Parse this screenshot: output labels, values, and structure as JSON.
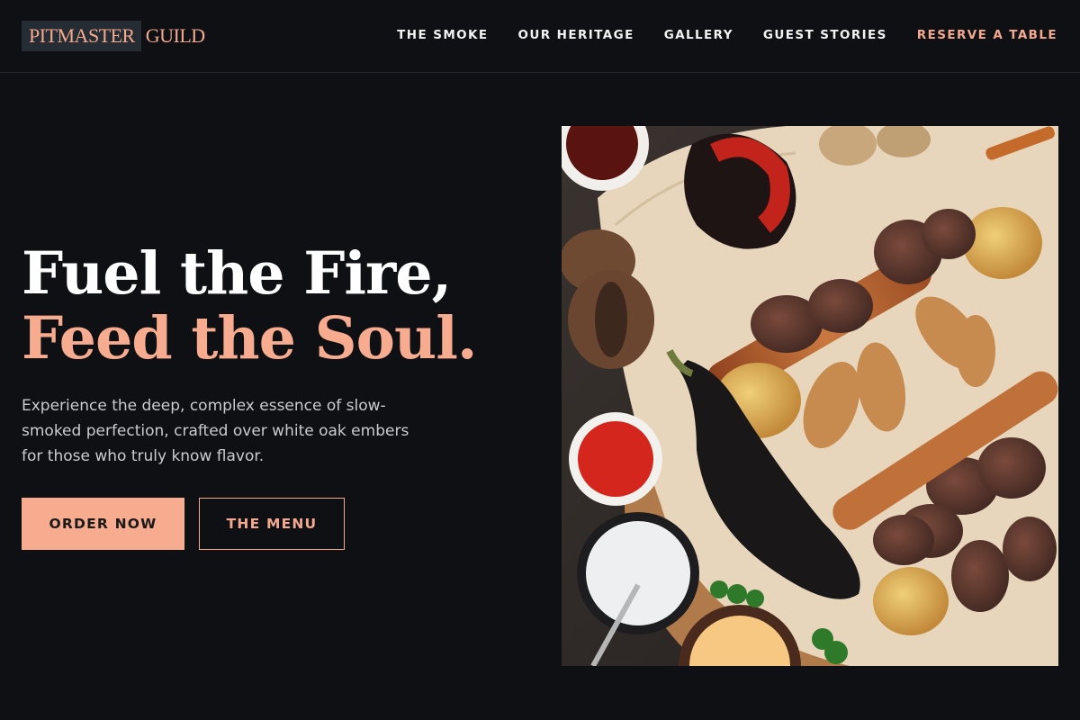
{
  "brand": {
    "part1": "PITMASTER",
    "part2": "GUILD"
  },
  "nav": {
    "items": [
      {
        "label": "THE SMOKE"
      },
      {
        "label": "OUR HERITAGE"
      },
      {
        "label": "GALLERY"
      },
      {
        "label": "GUEST STORIES"
      }
    ],
    "cta": "RESERVE A TABLE"
  },
  "hero": {
    "title_line1": "Fuel the Fire,",
    "title_line2": "Feed the Soul.",
    "subtitle": "Experience the deep, complex essence of slow-smoked perfection, crafted over white oak embers for those who truly know flavor.",
    "primary_button": "ORDER NOW",
    "secondary_button": "THE MENU"
  },
  "colors": {
    "background": "#0e1014",
    "accent": "#f7ab8f",
    "text": "#ffffff"
  }
}
